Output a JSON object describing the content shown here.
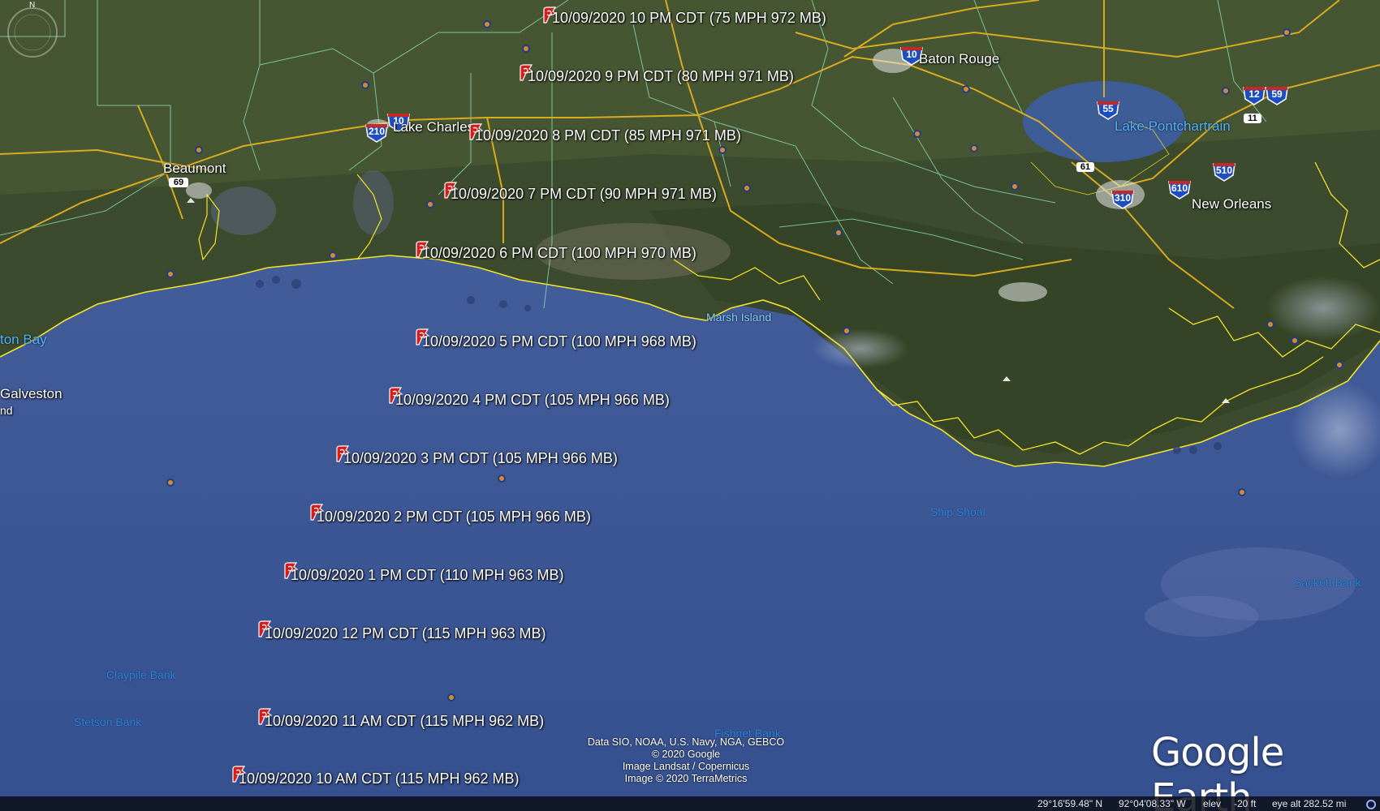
{
  "colors": {
    "water": "#3d5695",
    "land": "#3a4a2c",
    "coast": "#f2e52a",
    "roads": "#e0b020",
    "boundaries": "#8fe8c0"
  },
  "track_points": [
    "10/09/2020 10 PM CDT (75 MPH 972 MB)",
    "10/09/2020 9 PM CDT (80 MPH 971 MB)",
    "10/09/2020 8 PM CDT (85 MPH 971 MB)",
    "10/09/2020 7 PM CDT (90 MPH 971 MB)",
    "10/09/2020 6 PM CDT (100 MPH 970 MB)",
    "10/09/2020 5 PM CDT (100 MPH 968 MB)",
    "10/09/2020 4 PM CDT (105 MPH 966 MB)",
    "10/09/2020 3 PM CDT (105 MPH 966 MB)",
    "10/09/2020 2 PM CDT (105 MPH 966 MB)",
    "10/09/2020 1 PM CDT (110 MPH 963 MB)",
    "10/09/2020 12 PM CDT (115 MPH 963 MB)",
    "10/09/2020 11 AM CDT (115 MPH 962 MB)",
    "10/09/2020 10 AM CDT (115 MPH 962 MB)"
  ],
  "track_icon": "hurricane-icon",
  "places": {
    "baton_rouge": "Baton Rouge",
    "lake_charles": "Lake Charles",
    "beaumont": "Beaumont",
    "new_orleans": "New Orleans",
    "lake_pontchartrain": "Lake Pontchartrain",
    "marsh_island": "Marsh Island",
    "galveston_bay": "ton Bay",
    "galveston": "Galveston",
    "galveston_partial": "nd",
    "ship_shoal": "Ship Shoal",
    "sackett_bank": "Sackett Bank",
    "claypile_bank": "Claypile Bank",
    "stetson_bank": "Stetson Bank",
    "fishnet_bank": "Fishnet Bank"
  },
  "highway_shields": [
    "210",
    "10",
    "69",
    "10",
    "55",
    "12",
    "59",
    "11",
    "61",
    "310",
    "610",
    "510"
  ],
  "credits": [
    "Data SIO, NOAA, U.S. Navy, NGA, GEBCO",
    "© 2020 Google",
    "Image Landsat / Copernicus",
    "Image © 2020 TerraMetrics"
  ],
  "logo": "Google Earth",
  "compass_label": "N",
  "status": {
    "lat": "29°16'59.48\" N",
    "lon": "92°04'08.33\" W",
    "elev_label": "elev",
    "elev": "-20 ft",
    "eye_alt": "eye alt 282.52 mi"
  }
}
